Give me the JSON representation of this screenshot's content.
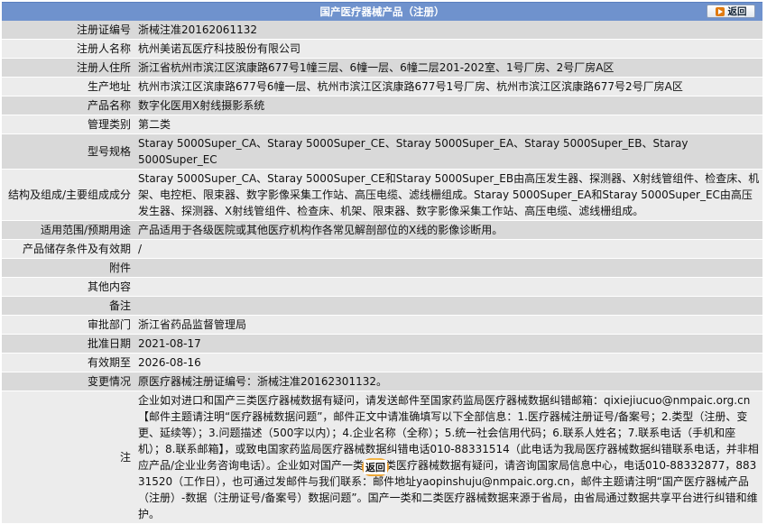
{
  "header": {
    "title": "国产医疗器械产品（注册）",
    "back_label": "返回"
  },
  "rows": [
    {
      "label": "注册证编号",
      "value": "浙械注准20162061132"
    },
    {
      "label": "注册人名称",
      "value": "杭州美诺瓦医疗科技股份有限公司"
    },
    {
      "label": "注册人住所",
      "value": "浙江省杭州市滨江区滨康路677号1幢三层、6幢一层、6幢二层201-202室、1号厂房、2号厂房A区"
    },
    {
      "label": "生产地址",
      "value": "杭州市滨江区滨康路677号6幢一层、杭州市滨江区滨康路677号1号厂房、杭州市滨江区滨康路677号2号厂房A区"
    },
    {
      "label": "产品名称",
      "value": "数字化医用X射线摄影系统"
    },
    {
      "label": "管理类别",
      "value": "第二类"
    },
    {
      "label": "型号规格",
      "value": "Staray 5000Super_CA、Staray 5000Super_CE、Staray 5000Super_EA、Staray 5000Super_EB、Staray 5000Super_EC"
    },
    {
      "label": "结构及组成/主要组成成分",
      "value": "Staray 5000Super_CA、Staray 5000Super_CE和Staray 5000Super_EB由高压发生器、探测器、X射线管组件、检查床、机架、电控柜、限束器、数字影像采集工作站、高压电缆、滤线栅组成。Staray 5000Super_EA和Staray 5000Super_EC由高压发生器、探测器、X射线管组件、检查床、机架、限束器、数字影像采集工作站、高压电缆、滤线栅组成。"
    },
    {
      "label": "适用范围/预期用途",
      "value": "产品适用于各级医院或其他医疗机构作各常见解剖部位的X线的影像诊断用。"
    },
    {
      "label": "产品储存条件及有效期",
      "value": "/"
    },
    {
      "label": "附件",
      "value": ""
    },
    {
      "label": "其他内容",
      "value": ""
    },
    {
      "label": "备注",
      "value": ""
    },
    {
      "label": "审批部门",
      "value": "浙江省药品监督管理局"
    },
    {
      "label": "批准日期",
      "value": "2021-08-17"
    },
    {
      "label": "有效期至",
      "value": "2026-08-16"
    },
    {
      "label": "变更情况",
      "value": "原医疗器械注册证编号：浙械注准20162301132。"
    },
    {
      "label": "注",
      "value": "企业如对进口和国产三类医疗器械数据有疑问，请发送邮件至国家药监局医疗器械数据纠错邮箱：qixiejiucuo@nmpaic.org.cn【邮件主题请注明“医疗器械数据问题”，邮件正文中请准确填写以下全部信息：1.医疗器械注册证号/备案号；2.类型（注册、变更、延续等）；3.问题描述（500字以内）；4.企业名称（全称）；5.统一社会信用代码；6.联系人姓名；7.联系电话（手机和座机）；8.联系邮箱】，或致电国家药监局医疗器械数据纠错电话010-88331514（此电话为我局医疗器械数据纠错联系电话，并非相应产品/企业业务咨询电话）。企业如对国产一类和二类医疗器械数据有疑问，请咨询国家局信息中心，电话010-88332877，88331520（工作日），也可通过发邮件与我们联系：邮件地址yaopinshuju@nmpaic.org.cn，邮件主题请注明“国产医疗器械产品（注册）-数据（注册证号/备案号）数据问题”。国产一类和二类医疗器械数据来源于省局，由省局通过数据共享平台进行纠错和维护。"
    }
  ],
  "footer": {
    "back_label": "返回"
  }
}
